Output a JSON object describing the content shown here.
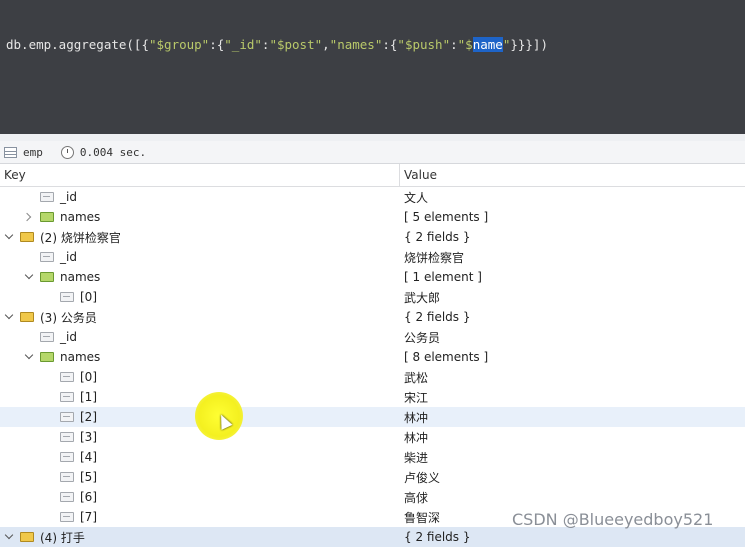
{
  "editor": {
    "code_tokens": [
      {
        "t": "db.emp.aggregate([{",
        "c": "id"
      },
      {
        "t": "\"$group\"",
        "c": "str"
      },
      {
        "t": ":{",
        "c": "id"
      },
      {
        "t": "\"_id\"",
        "c": "str"
      },
      {
        "t": ":",
        "c": "id"
      },
      {
        "t": "\"$post\"",
        "c": "str"
      },
      {
        "t": ",",
        "c": "id"
      },
      {
        "t": "\"names\"",
        "c": "str"
      },
      {
        "t": ":{",
        "c": "id"
      },
      {
        "t": "\"$push\"",
        "c": "str"
      },
      {
        "t": ":",
        "c": "id"
      },
      {
        "t": "\"$",
        "c": "str"
      },
      {
        "t": "name",
        "c": "hl"
      },
      {
        "t": "\"",
        "c": "str"
      },
      {
        "t": "}}}])",
        "c": "id"
      }
    ]
  },
  "status": {
    "collection": "emp",
    "time": "0.004 sec."
  },
  "table": {
    "key_header": "Key",
    "value_header": "Value",
    "rows": [
      {
        "level": 1,
        "chev": "",
        "icon": "field",
        "key": "_id",
        "value": "文人"
      },
      {
        "level": 1,
        "chev": "right",
        "icon": "arr",
        "key": "names",
        "value": "[ 5 elements ]"
      },
      {
        "level": 0,
        "chev": "down",
        "icon": "obj",
        "key": "(2) 烧饼检察官",
        "value": "{ 2 fields }"
      },
      {
        "level": 1,
        "chev": "",
        "icon": "field",
        "key": "_id",
        "value": "烧饼检察官"
      },
      {
        "level": 1,
        "chev": "down",
        "icon": "arr",
        "key": "names",
        "value": "[ 1 element ]"
      },
      {
        "level": 2,
        "chev": "",
        "icon": "field",
        "key": "[0]",
        "value": "武大郎"
      },
      {
        "level": 0,
        "chev": "down",
        "icon": "obj",
        "key": "(3) 公务员",
        "value": "{ 2 fields }"
      },
      {
        "level": 1,
        "chev": "",
        "icon": "field",
        "key": "_id",
        "value": "公务员"
      },
      {
        "level": 1,
        "chev": "down",
        "icon": "arr",
        "key": "names",
        "value": "[ 8 elements ]"
      },
      {
        "level": 2,
        "chev": "",
        "icon": "field",
        "key": "[0]",
        "value": "武松"
      },
      {
        "level": 2,
        "chev": "",
        "icon": "field",
        "key": "[1]",
        "value": "宋江"
      },
      {
        "level": 2,
        "chev": "",
        "icon": "field",
        "key": "[2]",
        "value": "林冲",
        "selected": true
      },
      {
        "level": 2,
        "chev": "",
        "icon": "field",
        "key": "[3]",
        "value": "林冲"
      },
      {
        "level": 2,
        "chev": "",
        "icon": "field",
        "key": "[4]",
        "value": "柴进"
      },
      {
        "level": 2,
        "chev": "",
        "icon": "field",
        "key": "[5]",
        "value": "卢俊义"
      },
      {
        "level": 2,
        "chev": "",
        "icon": "field",
        "key": "[6]",
        "value": "高俅"
      },
      {
        "level": 2,
        "chev": "",
        "icon": "field",
        "key": "[7]",
        "value": "鲁智深"
      },
      {
        "level": 0,
        "chev": "down",
        "icon": "obj",
        "key": "(4) 打手",
        "value": "{ 2 fields }",
        "partial": true
      }
    ]
  },
  "watermark": "CSDN @Blueeyedboy521"
}
